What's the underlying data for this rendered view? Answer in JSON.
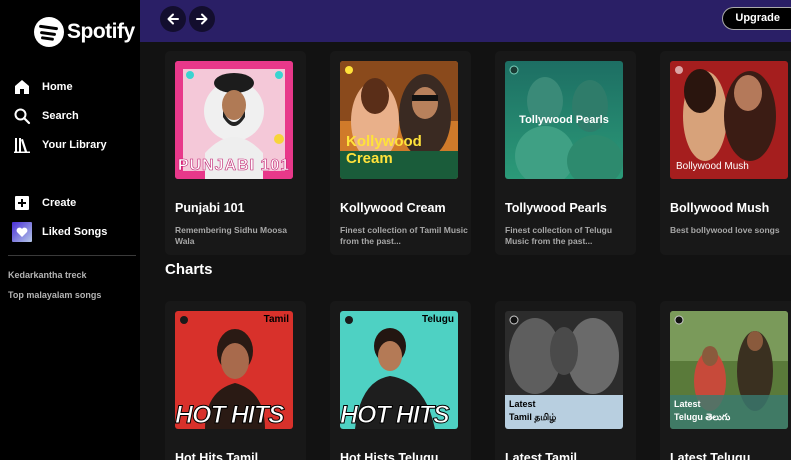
{
  "brand": {
    "name": "Spotify"
  },
  "sidebar": {
    "nav": [
      {
        "label": "Home",
        "icon": "home-icon"
      },
      {
        "label": "Search",
        "icon": "search-icon"
      },
      {
        "label": "Your Library",
        "icon": "library-icon"
      }
    ],
    "actions": [
      {
        "label": "Create",
        "icon": "plus-square-icon"
      },
      {
        "label": "Liked Songs",
        "icon": "heart-icon"
      }
    ],
    "playlists": [
      "Kedarkantha treck",
      "Top malayalam songs"
    ]
  },
  "topbar": {
    "back_icon": "arrow-left-icon",
    "forward_icon": "arrow-right-icon",
    "upgrade_label": "Upgrade"
  },
  "main": {
    "featured_cards": [
      {
        "title": "Punjabi 101",
        "description": "Remembering Sidhu Moosa Wala",
        "cover_text": "PUNJABI 101"
      },
      {
        "title": "Kollywood Cream",
        "description": "Finest collection of Tamil Music from the past...",
        "cover_text": "Kollywood Cream"
      },
      {
        "title": "Tollywood Pearls",
        "description": "Finest collection of Telugu Music from the past...",
        "cover_text": "Tollywood Pearls"
      },
      {
        "title": "Bollywood Mush",
        "description": "Best bollywood love songs",
        "cover_text": "Bollywood Mush"
      }
    ],
    "charts_title": "Charts",
    "chart_cards": [
      {
        "title": "Hot Hits Tamil",
        "cover_tag": "Tamil",
        "cover_text": "HOT HITS"
      },
      {
        "title": "Hot Hists Telugu",
        "cover_tag": "Telugu",
        "cover_text": "HOT HITS"
      },
      {
        "title": "Latest Tamil",
        "cover_line1": "Latest",
        "cover_line2": "Tamil தமிழ்"
      },
      {
        "title": "Latest Telugu",
        "cover_line1": "Latest",
        "cover_line2": "Telugu తెలుగు"
      }
    ]
  },
  "colors": {
    "topbar": "#2a1f66",
    "sidebar": "#000000",
    "background": "#121212",
    "card": "#181818"
  }
}
